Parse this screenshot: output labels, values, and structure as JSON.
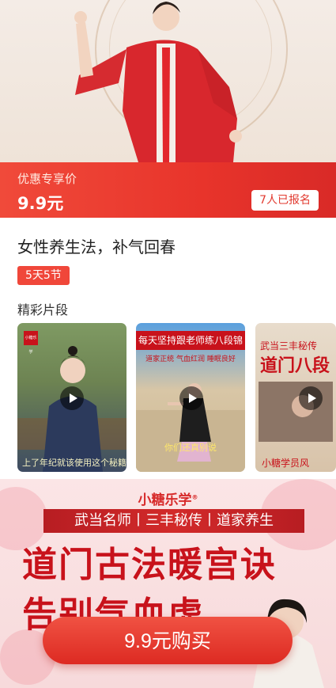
{
  "hero": {
    "image_alt": "太极演示"
  },
  "price": {
    "label": "优惠专享价",
    "value": "9.9元",
    "signup_count": "7人已报名"
  },
  "course": {
    "title": "女性养生法，补气回春",
    "tag": "5天5节"
  },
  "clips": {
    "section_title": "精彩片段",
    "items": [
      {
        "top_text": "小糖乐学",
        "caption": "上了年纪就该使用这个秘籍真功"
      },
      {
        "top_text": "每天坚持跟老师练八段锦",
        "sub_text": "道家正统 气血红润 睡眠良好",
        "caption": "你们还真别说"
      },
      {
        "top_text": "武当三丰秘传",
        "big_text": "道门八段",
        "caption": "小糖学员风"
      }
    ]
  },
  "promo": {
    "brand": "小糖乐学",
    "strip": "武当名师丨三丰秘传丨道家养生",
    "line1": "道门古法暖宫诀",
    "line2": "告别气血虚"
  },
  "buy_button": {
    "label": "9.9元购买"
  },
  "colors": {
    "accent": "#e8342b",
    "brand_red": "#c8121b"
  }
}
